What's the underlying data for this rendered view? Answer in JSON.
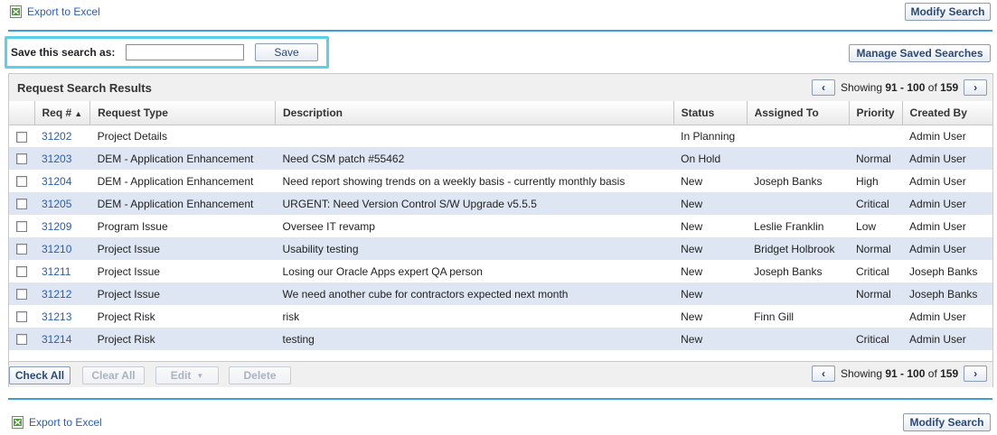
{
  "top_bar": {
    "export_label": "Export to Excel",
    "modify_search_label": "Modify Search"
  },
  "save_search": {
    "label": "Save this search as:",
    "input_value": "",
    "save_label": "Save",
    "manage_label": "Manage Saved Searches"
  },
  "results": {
    "title": "Request Search Results",
    "pager": {
      "prev": "‹",
      "next": "›",
      "prefix": "Showing",
      "range": "91 - 100",
      "of": "of",
      "total": "159"
    },
    "columns": [
      "Req #",
      "Request Type",
      "Description",
      "Status",
      "Assigned To",
      "Priority",
      "Created By"
    ],
    "sort_indicator": "▲",
    "rows": [
      {
        "req": "31202",
        "type": "Project Details",
        "desc": "",
        "status": "In Planning",
        "assigned": "",
        "priority": "",
        "created": "Admin User"
      },
      {
        "req": "31203",
        "type": "DEM - Application Enhancement",
        "desc": "Need CSM patch #55462",
        "status": "On Hold",
        "assigned": "",
        "priority": "Normal",
        "created": "Admin User"
      },
      {
        "req": "31204",
        "type": "DEM - Application Enhancement",
        "desc": "Need report showing trends on a weekly basis - currently monthly basis",
        "status": "New",
        "assigned": "Joseph Banks",
        "priority": "High",
        "created": "Admin User"
      },
      {
        "req": "31205",
        "type": "DEM - Application Enhancement",
        "desc": "URGENT: Need Version Control S/W Upgrade v5.5.5",
        "status": "New",
        "assigned": "",
        "priority": "Critical",
        "created": "Admin User"
      },
      {
        "req": "31209",
        "type": "Program Issue",
        "desc": "Oversee IT revamp",
        "status": "New",
        "assigned": "Leslie Franklin",
        "priority": "Low",
        "created": "Admin User"
      },
      {
        "req": "31210",
        "type": "Project Issue",
        "desc": "Usability testing",
        "status": "New",
        "assigned": "Bridget Holbrook",
        "priority": "Normal",
        "created": "Admin User"
      },
      {
        "req": "31211",
        "type": "Project Issue",
        "desc": "Losing our Oracle Apps expert QA person",
        "status": "New",
        "assigned": "Joseph Banks",
        "priority": "Critical",
        "created": "Joseph Banks"
      },
      {
        "req": "31212",
        "type": "Project Issue",
        "desc": "We need another cube for contractors expected next month",
        "status": "New",
        "assigned": "",
        "priority": "Normal",
        "created": "Joseph Banks"
      },
      {
        "req": "31213",
        "type": "Project Risk",
        "desc": "risk",
        "status": "New",
        "assigned": "Finn Gill",
        "priority": "",
        "created": "Admin User"
      },
      {
        "req": "31214",
        "type": "Project Risk",
        "desc": "testing",
        "status": "New",
        "assigned": "",
        "priority": "Critical",
        "created": "Admin User"
      }
    ],
    "footer": {
      "check_all": "Check All",
      "clear_all": "Clear All",
      "edit": "Edit",
      "edit_caret": "▼",
      "delete": "Delete"
    }
  },
  "bottom_bar": {
    "export_label": "Export to Excel",
    "modify_search_label": "Modify Search"
  },
  "colors": {
    "accent_rule": "#3d9bd8",
    "highlight_box": "#5ad0ea",
    "alt_row": "#dde6f2",
    "link": "#2a5db0"
  }
}
